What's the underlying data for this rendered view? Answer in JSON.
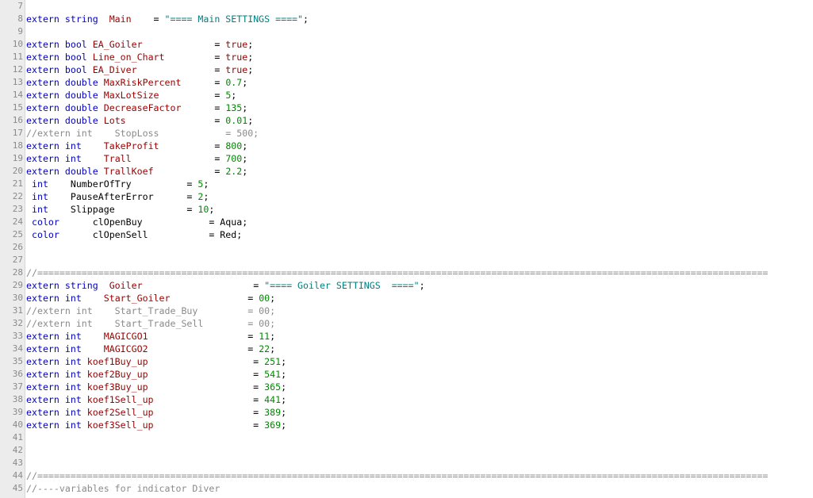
{
  "editor": {
    "lines": [
      {
        "n": "7",
        "t": []
      },
      {
        "n": "8",
        "t": [
          [
            "k",
            "extern string  "
          ],
          [
            "v",
            "Main"
          ],
          [
            "o",
            "    = "
          ],
          [
            "s",
            "\"==== Main SETTINGS ====\""
          ],
          [
            "o",
            ";"
          ]
        ]
      },
      {
        "n": "9",
        "t": []
      },
      {
        "n": "10",
        "t": [
          [
            "k",
            "extern bool "
          ],
          [
            "v",
            "EA_Goiler"
          ],
          [
            "o",
            "             = "
          ],
          [
            "v",
            "true"
          ],
          [
            "o",
            ";"
          ]
        ]
      },
      {
        "n": "11",
        "t": [
          [
            "k",
            "extern bool "
          ],
          [
            "v",
            "Line_on_Chart"
          ],
          [
            "o",
            "         = "
          ],
          [
            "v",
            "true"
          ],
          [
            "o",
            ";"
          ]
        ]
      },
      {
        "n": "12",
        "t": [
          [
            "k",
            "extern bool "
          ],
          [
            "v",
            "EA_Diver"
          ],
          [
            "o",
            "              = "
          ],
          [
            "v",
            "true"
          ],
          [
            "o",
            ";"
          ]
        ]
      },
      {
        "n": "13",
        "t": [
          [
            "k",
            "extern double "
          ],
          [
            "v",
            "MaxRiskPercent"
          ],
          [
            "o",
            "      = "
          ],
          [
            "n",
            "0.7"
          ],
          [
            "o",
            ";"
          ]
        ]
      },
      {
        "n": "14",
        "t": [
          [
            "k",
            "extern double "
          ],
          [
            "v",
            "MaxLotSize"
          ],
          [
            "o",
            "          = "
          ],
          [
            "n",
            "5"
          ],
          [
            "o",
            ";"
          ]
        ]
      },
      {
        "n": "15",
        "t": [
          [
            "k",
            "extern double "
          ],
          [
            "v",
            "DecreaseFactor"
          ],
          [
            "o",
            "      = "
          ],
          [
            "n",
            "135"
          ],
          [
            "o",
            ";"
          ]
        ]
      },
      {
        "n": "16",
        "t": [
          [
            "k",
            "extern double "
          ],
          [
            "v",
            "Lots"
          ],
          [
            "o",
            "                = "
          ],
          [
            "n",
            "0.01"
          ],
          [
            "o",
            ";"
          ]
        ]
      },
      {
        "n": "17",
        "t": [
          [
            "c",
            "//extern int    StopLoss            = 500;"
          ]
        ]
      },
      {
        "n": "18",
        "t": [
          [
            "k",
            "extern int    "
          ],
          [
            "v",
            "TakeProfit"
          ],
          [
            "o",
            "          = "
          ],
          [
            "n",
            "800"
          ],
          [
            "o",
            ";"
          ]
        ]
      },
      {
        "n": "19",
        "t": [
          [
            "k",
            "extern int    "
          ],
          [
            "v",
            "Trall"
          ],
          [
            "o",
            "               = "
          ],
          [
            "n",
            "700"
          ],
          [
            "o",
            ";"
          ]
        ]
      },
      {
        "n": "20",
        "t": [
          [
            "k",
            "extern double "
          ],
          [
            "v",
            "TrallKoef"
          ],
          [
            "o",
            "           = "
          ],
          [
            "n",
            "2.2"
          ],
          [
            "o",
            ";"
          ]
        ]
      },
      {
        "n": "21",
        "t": [
          [
            "k",
            " int    "
          ],
          [
            "o",
            "NumberOfTry          = "
          ],
          [
            "n",
            "5"
          ],
          [
            "o",
            ";"
          ]
        ]
      },
      {
        "n": "22",
        "t": [
          [
            "k",
            " int    "
          ],
          [
            "o",
            "PauseAfterError      = "
          ],
          [
            "n",
            "2"
          ],
          [
            "o",
            ";"
          ]
        ]
      },
      {
        "n": "23",
        "t": [
          [
            "k",
            " int    "
          ],
          [
            "o",
            "Slippage             = "
          ],
          [
            "n",
            "10"
          ],
          [
            "o",
            ";"
          ]
        ]
      },
      {
        "n": "24",
        "t": [
          [
            "k",
            " color      "
          ],
          [
            "o",
            "clOpenBuy            = Aqua;"
          ]
        ]
      },
      {
        "n": "25",
        "t": [
          [
            "k",
            " color      "
          ],
          [
            "o",
            "clOpenSell           = Red;"
          ]
        ]
      },
      {
        "n": "26",
        "t": []
      },
      {
        "n": "27",
        "t": []
      },
      {
        "n": "28",
        "t": [
          [
            "c",
            "//===================================================================================================================================="
          ]
        ]
      },
      {
        "n": "29",
        "t": [
          [
            "k",
            "extern string  "
          ],
          [
            "v",
            "Goiler"
          ],
          [
            "o",
            "                    = "
          ],
          [
            "s",
            "\"==== Goiler SETTINGS  ====\""
          ],
          [
            "o",
            ";"
          ]
        ]
      },
      {
        "n": "30",
        "t": [
          [
            "k",
            "extern int    "
          ],
          [
            "v",
            "Start_Goiler"
          ],
          [
            "o",
            "              = "
          ],
          [
            "n",
            "00"
          ],
          [
            "o",
            ";"
          ]
        ]
      },
      {
        "n": "31",
        "t": [
          [
            "c",
            "//extern int    Start_Trade_Buy         = 00;"
          ]
        ]
      },
      {
        "n": "32",
        "t": [
          [
            "c",
            "//extern int    Start_Trade_Sell        = 00;"
          ]
        ]
      },
      {
        "n": "33",
        "t": [
          [
            "k",
            "extern int    "
          ],
          [
            "v",
            "MAGICGO1"
          ],
          [
            "o",
            "                  = "
          ],
          [
            "n",
            "11"
          ],
          [
            "o",
            ";"
          ]
        ]
      },
      {
        "n": "34",
        "t": [
          [
            "k",
            "extern int    "
          ],
          [
            "v",
            "MAGICGO2"
          ],
          [
            "o",
            "                  = "
          ],
          [
            "n",
            "22"
          ],
          [
            "o",
            ";"
          ]
        ]
      },
      {
        "n": "35",
        "t": [
          [
            "k",
            "extern int "
          ],
          [
            "v",
            "koef1Buy_up"
          ],
          [
            "o",
            "                   = "
          ],
          [
            "n",
            "251"
          ],
          [
            "o",
            ";"
          ]
        ]
      },
      {
        "n": "36",
        "t": [
          [
            "k",
            "extern int "
          ],
          [
            "v",
            "koef2Buy_up"
          ],
          [
            "o",
            "                   = "
          ],
          [
            "n",
            "541"
          ],
          [
            "o",
            ";"
          ]
        ]
      },
      {
        "n": "37",
        "t": [
          [
            "k",
            "extern int "
          ],
          [
            "v",
            "koef3Buy_up"
          ],
          [
            "o",
            "                   = "
          ],
          [
            "n",
            "365"
          ],
          [
            "o",
            ";"
          ]
        ]
      },
      {
        "n": "38",
        "t": [
          [
            "k",
            "extern int "
          ],
          [
            "v",
            "koef1Sell_up"
          ],
          [
            "o",
            "                  = "
          ],
          [
            "n",
            "441"
          ],
          [
            "o",
            ";"
          ]
        ]
      },
      {
        "n": "39",
        "t": [
          [
            "k",
            "extern int "
          ],
          [
            "v",
            "koef2Sell_up"
          ],
          [
            "o",
            "                  = "
          ],
          [
            "n",
            "389"
          ],
          [
            "o",
            ";"
          ]
        ]
      },
      {
        "n": "40",
        "t": [
          [
            "k",
            "extern int "
          ],
          [
            "v",
            "koef3Sell_up"
          ],
          [
            "o",
            "                  = "
          ],
          [
            "n",
            "369"
          ],
          [
            "o",
            ";"
          ]
        ]
      },
      {
        "n": "41",
        "t": []
      },
      {
        "n": "42",
        "t": []
      },
      {
        "n": "43",
        "t": []
      },
      {
        "n": "44",
        "t": [
          [
            "c",
            "//===================================================================================================================================="
          ]
        ]
      },
      {
        "n": "45",
        "t": [
          [
            "c",
            "//----variables for indicator Diver"
          ]
        ]
      }
    ]
  },
  "colors": {
    "keyword": "#0000cc",
    "identifier": "#990000",
    "number": "#008800",
    "string": "#008080",
    "comment": "#8a8a8a",
    "plain": "#000000",
    "line_number": "#8a8a8a",
    "gutter": "#ececec"
  }
}
